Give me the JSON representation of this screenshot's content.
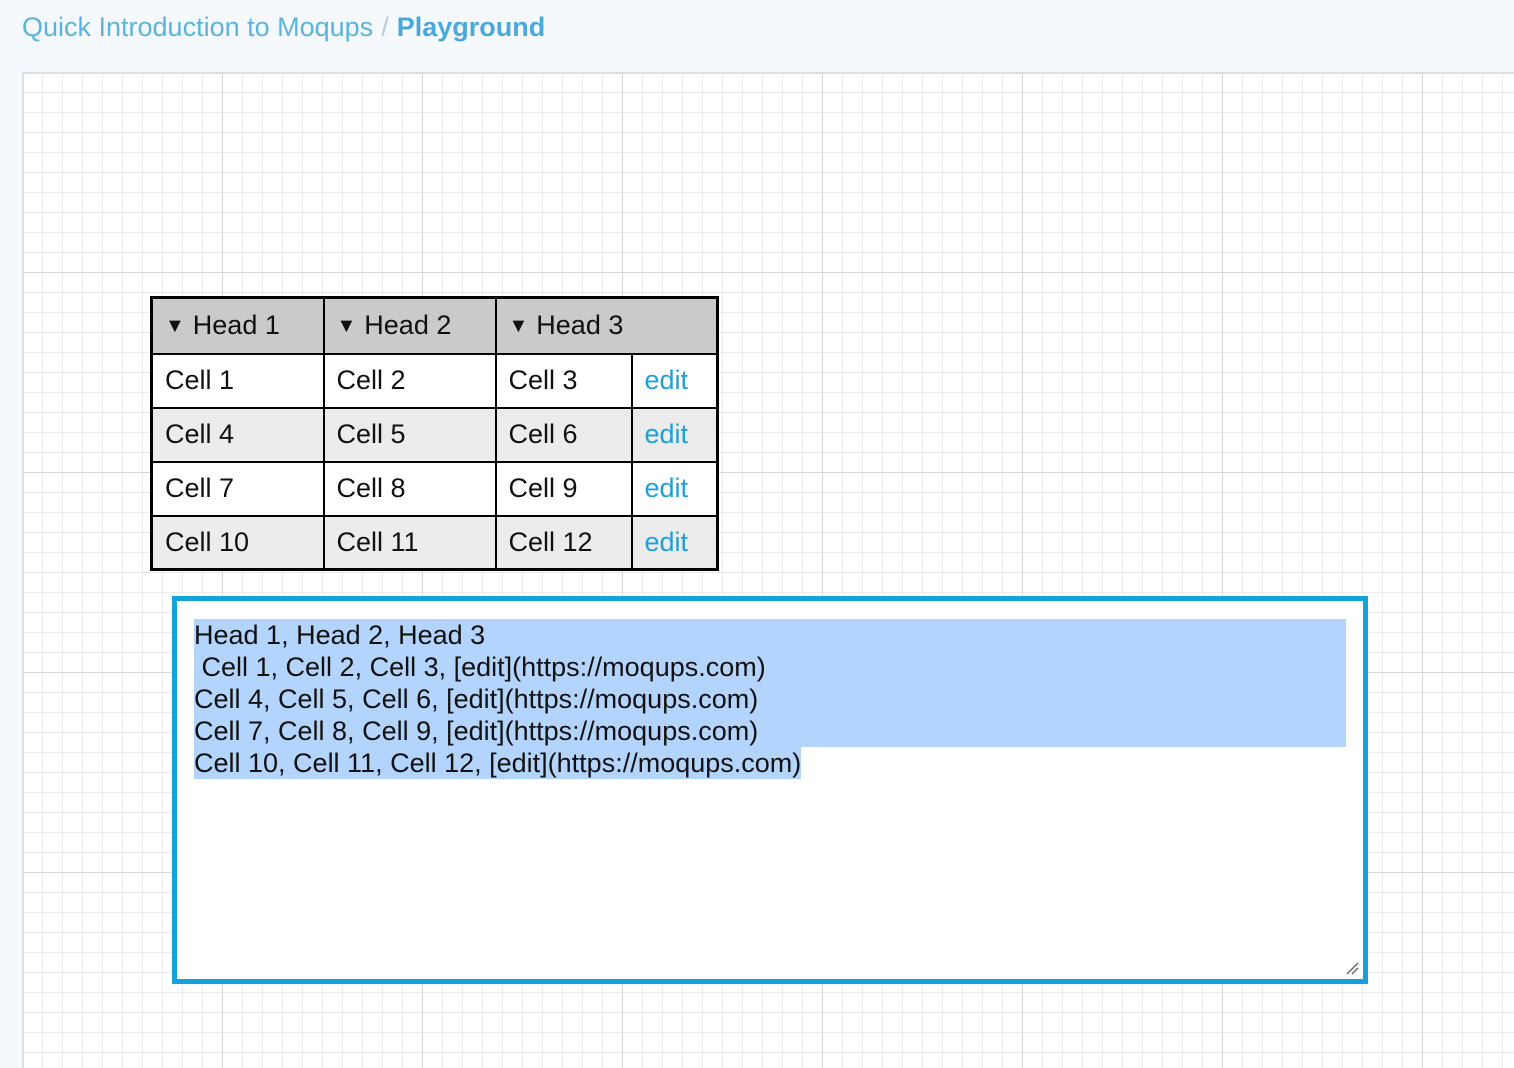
{
  "breadcrumb": {
    "parent": "Quick Introduction to Moqups",
    "separator": "/",
    "current": "Playground"
  },
  "table": {
    "headers": [
      "Head 1",
      "Head 2",
      "Head 3"
    ],
    "sort_icon": "▼",
    "rows": [
      {
        "cells": [
          "Cell 1",
          "Cell 2",
          "Cell 3"
        ],
        "action": "edit"
      },
      {
        "cells": [
          "Cell 4",
          "Cell 5",
          "Cell 6"
        ],
        "action": "edit"
      },
      {
        "cells": [
          "Cell 7",
          "Cell 8",
          "Cell 9"
        ],
        "action": "edit"
      },
      {
        "cells": [
          "Cell 10",
          "Cell 11",
          "Cell 12"
        ],
        "action": "edit"
      }
    ]
  },
  "editor": {
    "lines": [
      "Head 1, Head 2, Head 3",
      " Cell 1, Cell 2, Cell 3, [edit](https://moqups.com)",
      "Cell 4, Cell 5, Cell 6, [edit](https://moqups.com)",
      "Cell 7, Cell 8, Cell 9, [edit](https://moqups.com)",
      "Cell 10, Cell 11, Cell 12, [edit](https://moqups.com)"
    ]
  },
  "colors": {
    "accent": "#12a3dc",
    "link": "#1ea0dd",
    "header_bg": "#cacaca",
    "alt_row_bg": "#ececec",
    "selection": "#b3d4fc"
  }
}
